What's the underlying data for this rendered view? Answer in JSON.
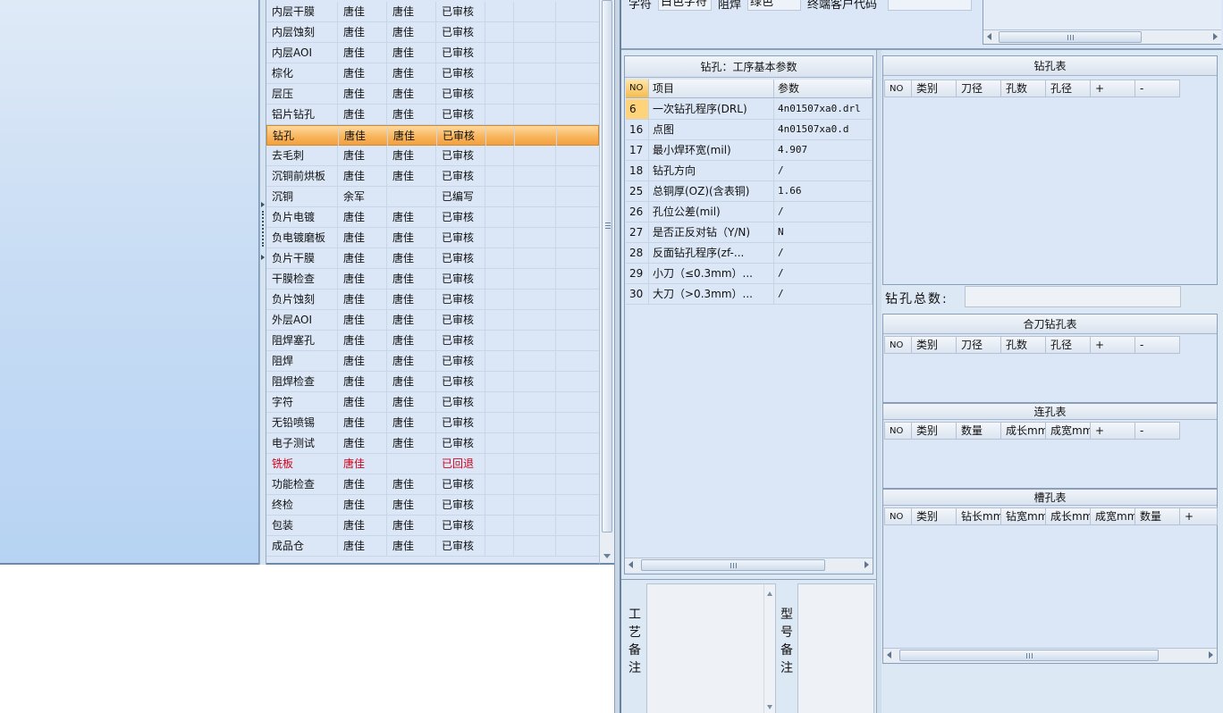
{
  "process_list": {
    "rows": [
      {
        "name": "内层干膜",
        "editor": "唐佳",
        "reviewer": "唐佳",
        "status": "已审核"
      },
      {
        "name": "内层蚀刻",
        "editor": "唐佳",
        "reviewer": "唐佳",
        "status": "已审核"
      },
      {
        "name": "内层AOI",
        "editor": "唐佳",
        "reviewer": "唐佳",
        "status": "已审核"
      },
      {
        "name": "棕化",
        "editor": "唐佳",
        "reviewer": "唐佳",
        "status": "已审核"
      },
      {
        "name": "层压",
        "editor": "唐佳",
        "reviewer": "唐佳",
        "status": "已审核"
      },
      {
        "name": "铝片钻孔",
        "editor": "唐佳",
        "reviewer": "唐佳",
        "status": "已审核"
      },
      {
        "name": "钻孔",
        "editor": "唐佳",
        "reviewer": "唐佳",
        "status": "已审核"
      },
      {
        "name": "去毛刺",
        "editor": "唐佳",
        "reviewer": "唐佳",
        "status": "已审核"
      },
      {
        "name": "沉铜前烘板",
        "editor": "唐佳",
        "reviewer": "唐佳",
        "status": "已审核"
      },
      {
        "name": "沉铜",
        "editor": "余军",
        "reviewer": "",
        "status": "已编写"
      },
      {
        "name": "负片电镀",
        "editor": "唐佳",
        "reviewer": "唐佳",
        "status": "已审核"
      },
      {
        "name": "负电镀磨板",
        "editor": "唐佳",
        "reviewer": "唐佳",
        "status": "已审核"
      },
      {
        "name": "负片干膜",
        "editor": "唐佳",
        "reviewer": "唐佳",
        "status": "已审核"
      },
      {
        "name": "干膜检查",
        "editor": "唐佳",
        "reviewer": "唐佳",
        "status": "已审核"
      },
      {
        "name": "负片蚀刻",
        "editor": "唐佳",
        "reviewer": "唐佳",
        "status": "已审核"
      },
      {
        "name": "外层AOI",
        "editor": "唐佳",
        "reviewer": "唐佳",
        "status": "已审核"
      },
      {
        "name": "阻焊塞孔",
        "editor": "唐佳",
        "reviewer": "唐佳",
        "status": "已审核"
      },
      {
        "name": "阻焊",
        "editor": "唐佳",
        "reviewer": "唐佳",
        "status": "已审核"
      },
      {
        "name": "阻焊检查",
        "editor": "唐佳",
        "reviewer": "唐佳",
        "status": "已审核"
      },
      {
        "name": "字符",
        "editor": "唐佳",
        "reviewer": "唐佳",
        "status": "已审核"
      },
      {
        "name": "无铅喷锡",
        "editor": "唐佳",
        "reviewer": "唐佳",
        "status": "已审核"
      },
      {
        "name": "电子测试",
        "editor": "唐佳",
        "reviewer": "唐佳",
        "status": "已审核"
      },
      {
        "name": "铣板",
        "editor": "唐佳",
        "reviewer": "",
        "status": "已回退"
      },
      {
        "name": "功能检查",
        "editor": "唐佳",
        "reviewer": "唐佳",
        "status": "已审核"
      },
      {
        "name": "终检",
        "editor": "唐佳",
        "reviewer": "唐佳",
        "status": "已审核"
      },
      {
        "name": "包装",
        "editor": "唐佳",
        "reviewer": "唐佳",
        "status": "已审核"
      },
      {
        "name": "成品仓",
        "editor": "唐佳",
        "reviewer": "唐佳",
        "status": "已审核"
      }
    ],
    "selected_name": "钻孔",
    "rejected_name": "铣板"
  },
  "top_info": {
    "char_label": "字符",
    "char_value": "白色字符",
    "solder_label": "阻焊",
    "solder_value": "绿色",
    "end_customer_label": "终端客户代码",
    "end_customer_value": ""
  },
  "params": {
    "title": "钻孔：工序基本参数",
    "col_no": "NO",
    "col_item": "项目",
    "col_value": "参数",
    "rows": [
      {
        "no": "6",
        "item": "一次钻孔程序(DRL)",
        "value": "4n01507xa0.drl"
      },
      {
        "no": "16",
        "item": "点图",
        "value": "4n01507xa0.d"
      },
      {
        "no": "17",
        "item": "最小焊环宽(mil)",
        "value": "4.907"
      },
      {
        "no": "18",
        "item": "钻孔方向",
        "value": "/"
      },
      {
        "no": "25",
        "item": "总铜厚(OZ)(含表铜)",
        "value": "1.66"
      },
      {
        "no": "26",
        "item": "孔位公差(mil)",
        "value": "/"
      },
      {
        "no": "27",
        "item": "是否正反对钻（Y/N)",
        "value": "N"
      },
      {
        "no": "28",
        "item": "反面钻孔程序(zf-...",
        "value": "/"
      },
      {
        "no": "29",
        "item": "小刀（≤0.3mm）...",
        "value": "/"
      },
      {
        "no": "30",
        "item": "大刀（>0.3mm）...",
        "value": "/"
      }
    ]
  },
  "notes": {
    "process_note_label": "工艺备注",
    "model_note_label": "型号备注"
  },
  "drill_table": {
    "title": "钻孔表",
    "columns": [
      "NO",
      "类别",
      "刀径",
      "孔数",
      "孔径",
      "+",
      "-"
    ]
  },
  "drill_total": {
    "label": "钻孔总数:",
    "value": ""
  },
  "combined_drill_table": {
    "title": "合刀钻孔表",
    "columns": [
      "NO",
      "类别",
      "刀径",
      "孔数",
      "孔径",
      "+",
      "-"
    ]
  },
  "linked_hole_table": {
    "title": "连孔表",
    "columns": [
      "NO",
      "类别",
      "数量",
      "成长mm",
      "成宽mm",
      "+",
      "-"
    ]
  },
  "slot_table": {
    "title": "槽孔表",
    "columns": [
      "NO",
      "类别",
      "钻长mm",
      "钻宽mm",
      "成长mm",
      "成宽mm",
      "数量",
      "+"
    ]
  },
  "colors": {
    "selected_row": "#f7b35a",
    "rejected_text": "#d0021b",
    "panel_bg": "#dbe7f6"
  }
}
